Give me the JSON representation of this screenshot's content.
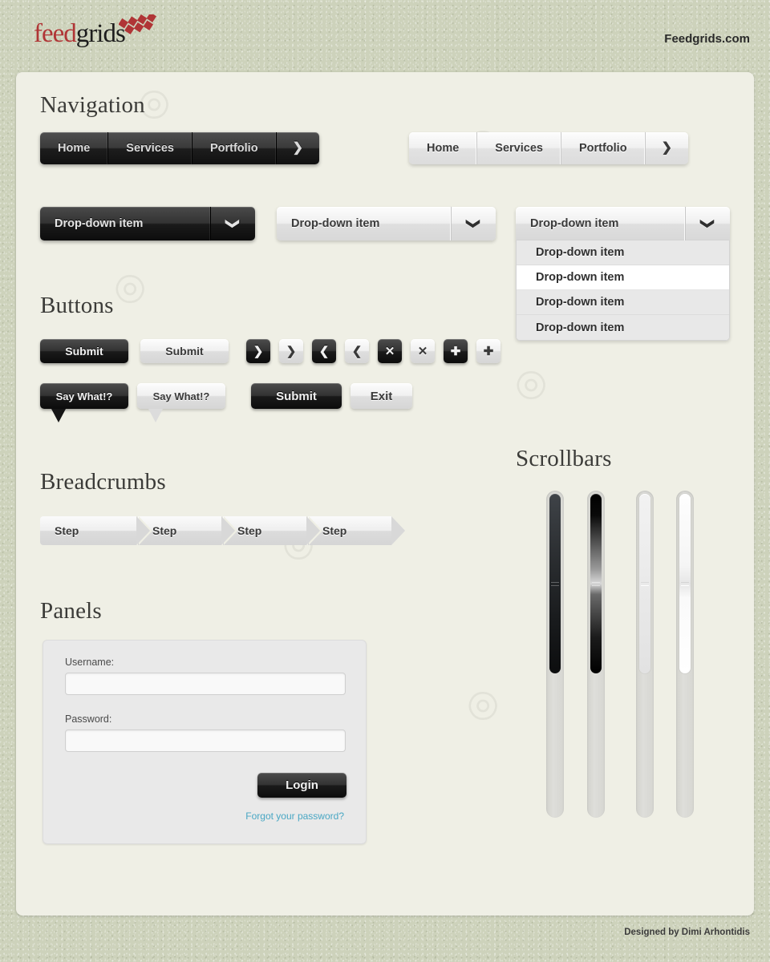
{
  "header": {
    "logo_first": "feed",
    "logo_second": "grids",
    "site_url": "Feedgrids.com"
  },
  "footer": {
    "credit": "Designed by Dimi Arhontidis"
  },
  "sections": {
    "navigation": "Navigation",
    "buttons": "Buttons",
    "breadcrumbs": "Breadcrumbs",
    "panels": "Panels",
    "scrollbars": "Scrollbars"
  },
  "navbar_dark": {
    "items": [
      "Home",
      "Services",
      "Portfolio"
    ],
    "arrow_icon": "❯"
  },
  "navbar_light": {
    "items": [
      "Home",
      "Services",
      "Portfolio"
    ],
    "arrow_icon": "❯"
  },
  "dropdowns": {
    "dark_label": "Drop-down item",
    "light_label": "Drop-down item",
    "open_label": "Drop-down item",
    "caret_icon": "❯",
    "options": [
      {
        "label": "Drop-down item",
        "highlighted": false
      },
      {
        "label": "Drop-down item",
        "highlighted": true
      },
      {
        "label": "Drop-down item",
        "highlighted": false
      },
      {
        "label": "Drop-down item",
        "highlighted": false
      }
    ]
  },
  "buttons": {
    "submit_dark": "Submit",
    "submit_light": "Submit",
    "icon_buttons": [
      {
        "icon": "❯",
        "name": "chevron-right-icon",
        "style": "dark"
      },
      {
        "icon": "❯",
        "name": "chevron-right-icon",
        "style": "light"
      },
      {
        "icon": "❮",
        "name": "chevron-left-icon",
        "style": "dark"
      },
      {
        "icon": "❮",
        "name": "chevron-left-icon",
        "style": "light"
      },
      {
        "icon": "✕",
        "name": "close-x-icon",
        "style": "dark"
      },
      {
        "icon": "✕",
        "name": "close-x-icon",
        "style": "light"
      },
      {
        "icon": "✚",
        "name": "plus-icon",
        "style": "dark"
      },
      {
        "icon": "✚",
        "name": "plus-icon",
        "style": "light"
      }
    ],
    "tooltip_dark": "Say What!?",
    "tooltip_light": "Say What!?",
    "submit_big": "Submit",
    "exit_big": "Exit"
  },
  "breadcrumbs": {
    "steps": [
      "Step",
      "Step",
      "Step",
      "Step"
    ]
  },
  "panel": {
    "username_label": "Username:",
    "username_value": "",
    "username_placeholder": "",
    "password_label": "Password:",
    "password_value": "",
    "password_placeholder": "",
    "login_button": "Login",
    "forgot_link": "Forgot your password?"
  },
  "scrollbars": [
    {
      "style": "dark-flat",
      "thumb_percent": 61
    },
    {
      "style": "dark-gloss",
      "thumb_percent": 61
    },
    {
      "style": "light-flat",
      "thumb_percent": 61
    },
    {
      "style": "light-gloss",
      "thumb_percent": 61
    }
  ],
  "colors": {
    "page_bg": "#cdd2bb",
    "sheet_bg": "#efefe5",
    "logo_red": "#b03536",
    "link_blue": "#49a7c4",
    "dark_btn": "#1a1a1a",
    "light_btn": "#dedede"
  }
}
